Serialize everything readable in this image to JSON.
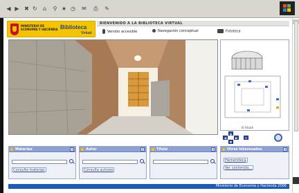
{
  "browser": {
    "toolbar_icons": [
      "back-icon",
      "forward-icon",
      "stop-icon",
      "refresh-icon",
      "home-icon",
      "search-icon",
      "favorites-icon",
      "history-icon",
      "mail-icon",
      "print-icon",
      "edit-icon"
    ]
  },
  "header": {
    "ministry_name": "Ministerio de Economía y Hacienda",
    "library_title": "Biblioteca",
    "library_subtitle": "Virtual",
    "welcome": "BIENVENIDO A LA BIBLIOTECA VIRTUAL",
    "modes": [
      {
        "label": "Versión accesible",
        "icon": "person-icon"
      },
      {
        "label": "Navegación conceptual",
        "icon": "network-icon"
      },
      {
        "label": "Fototeca",
        "icon": "camera-icon"
      }
    ]
  },
  "map": {
    "caption": "El Alcalá"
  },
  "panels": [
    {
      "title": "Materias",
      "input": "",
      "links": [
        "Consulta materias"
      ]
    },
    {
      "title": "Autor",
      "input": "",
      "links": [
        "Consulta autores"
      ]
    },
    {
      "title": "Título",
      "input": "",
      "links": []
    },
    {
      "title": "Otros Interesados",
      "input": null,
      "links": [
        "Hemeroteca",
        "Ver contenido..."
      ]
    }
  ],
  "footer": {
    "text": "Ministerio de Economía y Hacienda 2006"
  },
  "colors": {
    "brand_yellow": "#f5c400",
    "brand_blue": "#2a3e88",
    "panel_header": "#8ea0d4",
    "footer": "#1c5ab8"
  }
}
